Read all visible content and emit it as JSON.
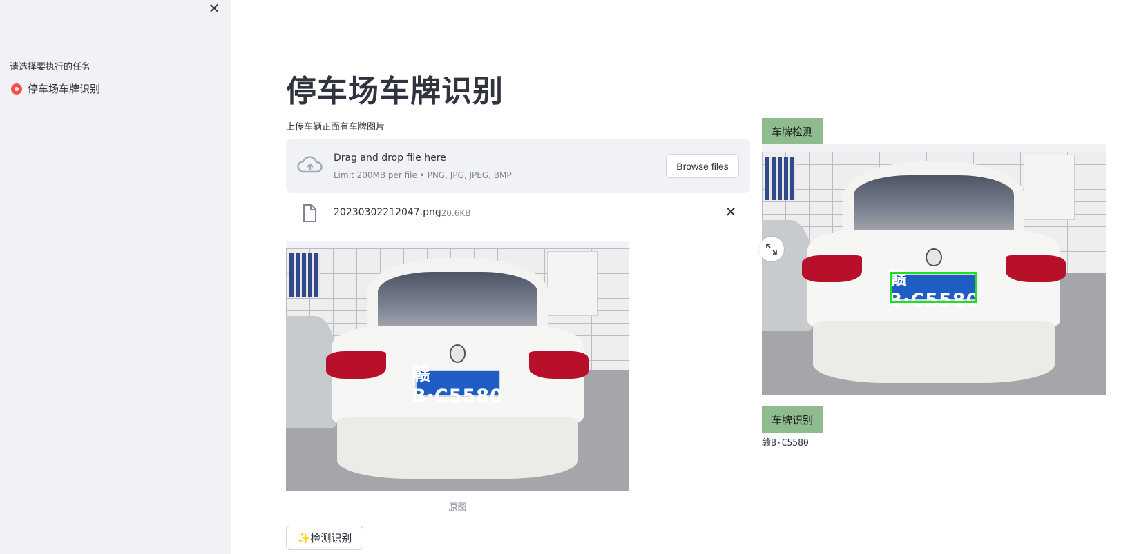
{
  "sidebar": {
    "close_icon": "close-icon",
    "task_label": "请选择要执行的任务",
    "options": [
      {
        "label": "停车场车牌识别",
        "selected": true
      }
    ],
    "accent_color": "#ff4b4b"
  },
  "main": {
    "title": "停车场车牌识别",
    "uploader": {
      "label": "上传车辆正面有车牌图片",
      "drop_title": "Drag and drop file here",
      "drop_limits": "Limit 200MB per file • PNG, JPG, JPEG, BMP",
      "browse_label": "Browse files",
      "icon": "cloud-upload-icon"
    },
    "file": {
      "name": "20230302212047.png",
      "size": "320.6KB",
      "icon": "file-icon",
      "remove_icon": "close-icon"
    },
    "original_image": {
      "caption": "原图",
      "plate_text": "赣B·C5580"
    },
    "detect_button_label": "✨检测识别"
  },
  "results": {
    "detect_tag": "车牌检测",
    "detection_image": {
      "plate_text": "赣B·C5580",
      "box_color": "#22dd22"
    },
    "recognize_tag": "车牌识别",
    "plate_text": "赣B·C5580",
    "tag_color": "#8fbc8f",
    "fullscreen_icon": "expand-icon"
  }
}
